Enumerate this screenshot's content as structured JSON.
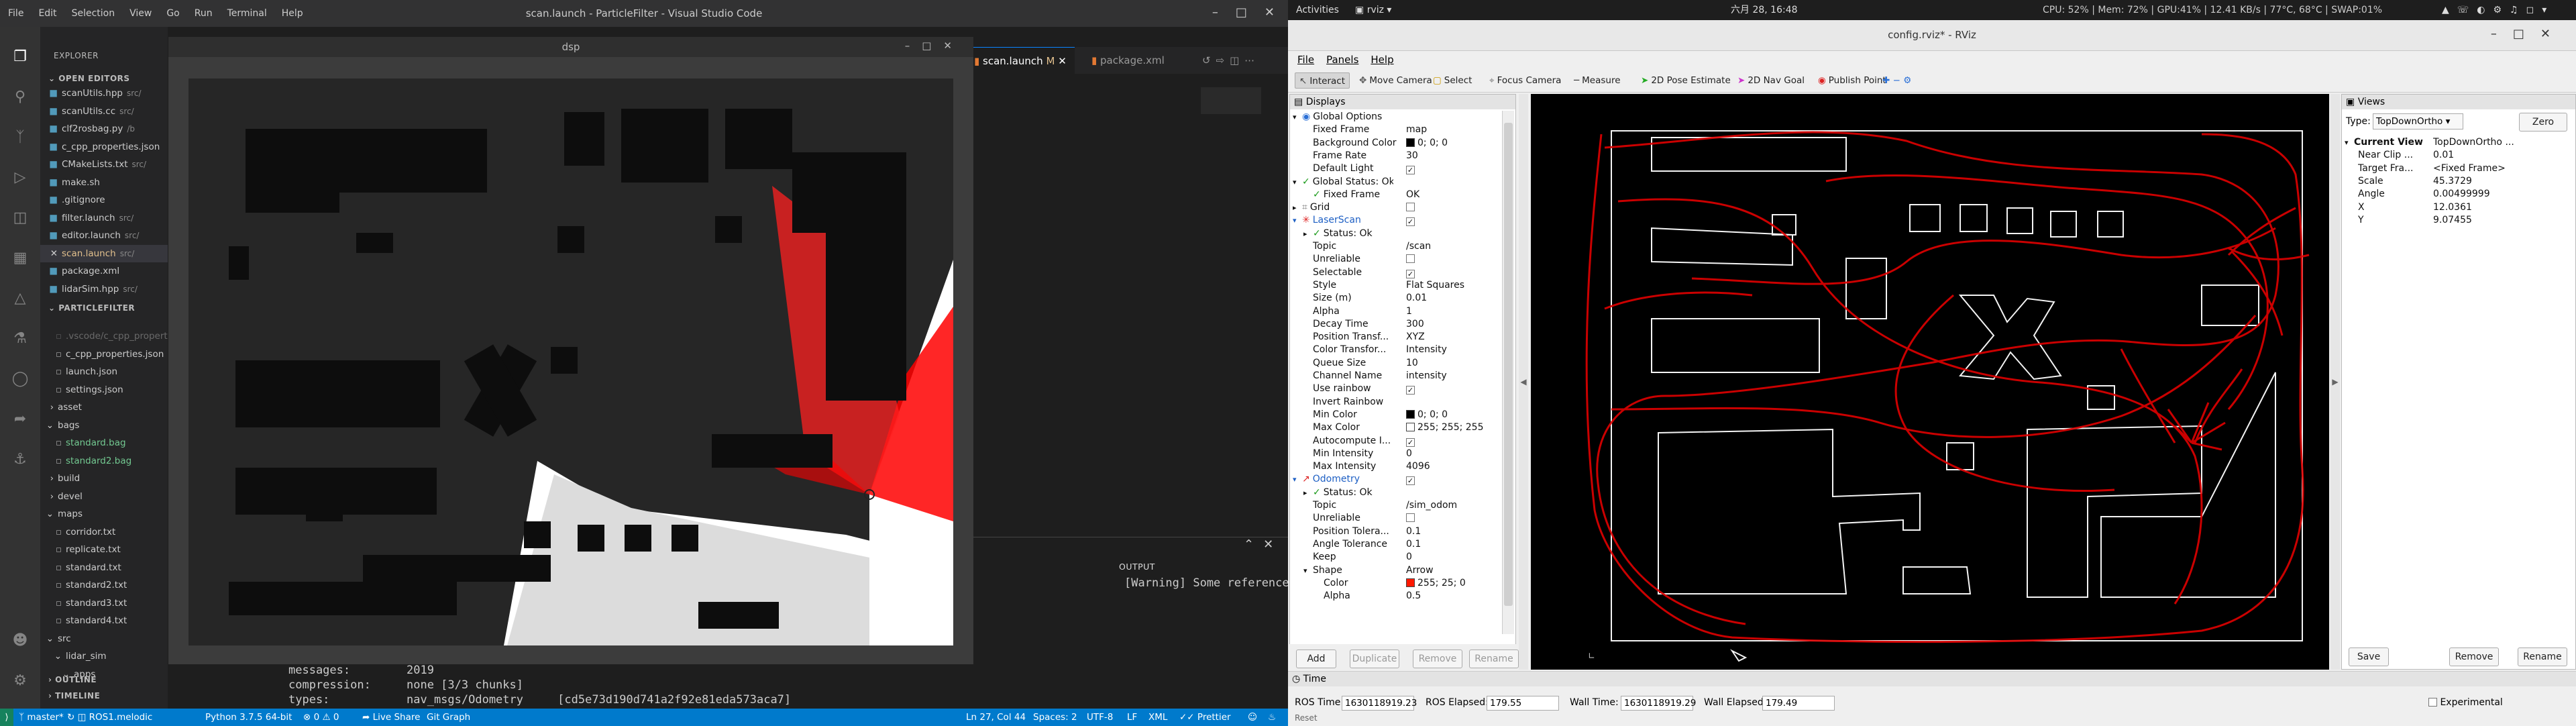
{
  "vscode": {
    "menu": [
      "File",
      "Edit",
      "Selection",
      "View",
      "Go",
      "Run",
      "Terminal",
      "Help"
    ],
    "window_title": "scan.launch - ParticleFilter - Visual Studio Code",
    "explorer_title": "EXPLORER",
    "open_editors_title": "OPEN EDITORS",
    "open_editors": [
      "scanUtils.hpp",
      "scanUtils.cc",
      "clf2rosbag.py",
      "c_cpp_properties.json",
      "CMakeLists.txt",
      "make.sh",
      ".gitignore",
      "filter.launch",
      "editor.launch",
      "scan.launch",
      "package.xml",
      "lidarSim.hpp"
    ],
    "open_editor_hints": [
      "src/",
      "src/",
      "/b",
      "",
      "src/",
      "",
      "",
      "src/",
      "src/",
      "src/",
      "",
      "src/"
    ],
    "project_title": "PARTICLEFILTER",
    "project_items": [
      ".vscode/c_cpp_properties.json",
      "c_cpp_properties.json",
      "launch.json",
      "settings.json",
      "asset",
      "bags",
      "standard.bag",
      "standard2.bag",
      "build",
      "devel",
      "maps",
      "corridor.txt",
      "replicate.txt",
      "standard.txt",
      "standard2.txt",
      "standard3.txt",
      "standard4.txt",
      "src",
      "lidar_sim",
      "apps"
    ],
    "outline_title": "OUTLINE",
    "timeline_title": "TIMELINE",
    "tabs": [
      "scan.launch",
      "package.xml"
    ],
    "tab_modified": "M",
    "dsp_title": "dsp",
    "output_tab": "OUTPUT",
    "output_text": "[Warning] Some references",
    "terminal_lines": [
      {
        "k": "messages:",
        "v": "2019"
      },
      {
        "k": "compression:",
        "v": "none [3/3 chunks]"
      },
      {
        "k": "types:",
        "v": "nav_msgs/Odometry     [cd5e73d190d741a2f92e81eda573aca7]"
      }
    ],
    "status": {
      "branch": "master*",
      "ros": "ROS1.melodic",
      "python": "Python 3.7.5 64-bit",
      "problems": "0 ⚠ 0",
      "live_share": "Live Share",
      "git_graph": "Git Graph",
      "position": "Ln 27, Col 44",
      "spaces": "Spaces: 2",
      "encoding": "UTF-8",
      "eol": "LF",
      "lang": "XML",
      "prettier": "Prettier"
    }
  },
  "gnome": {
    "activities": "Activities",
    "app": "rviz",
    "clock": "六月 28, 16:48",
    "stats": "CPU: 52% | Mem: 72% | GPU:41% | 12.41 KB/s | 77°C, 68°C | SWAP:01%"
  },
  "rviz": {
    "title": "config.rviz* - RViz",
    "menu": [
      "File",
      "Panels",
      "Help"
    ],
    "tools": [
      "Interact",
      "Move Camera",
      "Select",
      "Focus Camera",
      "Measure",
      "2D Pose Estimate",
      "2D Nav Goal",
      "Publish Point"
    ],
    "displays_title": "Displays",
    "display_rows": [
      {
        "k": "Global Options",
        "v": "",
        "lvl": 0,
        "exp": "▾",
        "icon": "globe"
      },
      {
        "k": "Fixed Frame",
        "v": "map",
        "lvl": 1
      },
      {
        "k": "Background Color",
        "v": "0; 0; 0",
        "lvl": 1,
        "sw": "#000000"
      },
      {
        "k": "Frame Rate",
        "v": "30",
        "lvl": 1
      },
      {
        "k": "Default Light",
        "v": "",
        "lvl": 1,
        "chk": "✓"
      },
      {
        "k": "Global Status: Ok",
        "v": "",
        "lvl": 0,
        "exp": "▾",
        "icon": "ok"
      },
      {
        "k": "Fixed Frame",
        "v": "OK",
        "lvl": 1,
        "icon": "ok"
      },
      {
        "k": "Grid",
        "v": "",
        "lvl": 0,
        "exp": "▸",
        "icon": "grid",
        "chk": " "
      },
      {
        "k": "LaserScan",
        "v": "",
        "lvl": 0,
        "exp": "▾",
        "icon": "laser",
        "chk": "✓",
        "blue": true
      },
      {
        "k": "Status: Ok",
        "v": "",
        "lvl": 1,
        "exp": "▸",
        "icon": "ok"
      },
      {
        "k": "Topic",
        "v": "/scan",
        "lvl": 1
      },
      {
        "k": "Unreliable",
        "v": "",
        "lvl": 1,
        "chk": " "
      },
      {
        "k": "Selectable",
        "v": "",
        "lvl": 1,
        "chk": "✓"
      },
      {
        "k": "Style",
        "v": "Flat Squares",
        "lvl": 1
      },
      {
        "k": "Size (m)",
        "v": "0.01",
        "lvl": 1
      },
      {
        "k": "Alpha",
        "v": "1",
        "lvl": 1
      },
      {
        "k": "Decay Time",
        "v": "300",
        "lvl": 1
      },
      {
        "k": "Position Transf...",
        "v": "XYZ",
        "lvl": 1
      },
      {
        "k": "Color Transfor...",
        "v": "Intensity",
        "lvl": 1
      },
      {
        "k": "Queue Size",
        "v": "10",
        "lvl": 1
      },
      {
        "k": "Channel Name",
        "v": "intensity",
        "lvl": 1
      },
      {
        "k": "Use rainbow",
        "v": "",
        "lvl": 1,
        "chk": "✓"
      },
      {
        "k": "Invert Rainbow",
        "v": "",
        "lvl": 1
      },
      {
        "k": "Min Color",
        "v": "0; 0; 0",
        "lvl": 1,
        "sw": "#000000"
      },
      {
        "k": "Max Color",
        "v": "255; 255; 255",
        "lvl": 1,
        "sw": "#ffffff"
      },
      {
        "k": "Autocompute I...",
        "v": "",
        "lvl": 1,
        "chk": "✓"
      },
      {
        "k": "Min Intensity",
        "v": "0",
        "lvl": 1
      },
      {
        "k": "Max Intensity",
        "v": "4096",
        "lvl": 1
      },
      {
        "k": "Odometry",
        "v": "",
        "lvl": 0,
        "exp": "▾",
        "icon": "odom",
        "chk": "✓",
        "blue": true
      },
      {
        "k": "Status: Ok",
        "v": "",
        "lvl": 1,
        "exp": "▸",
        "icon": "ok"
      },
      {
        "k": "Topic",
        "v": "/sim_odom",
        "lvl": 1
      },
      {
        "k": "Unreliable",
        "v": "",
        "lvl": 1,
        "chk": " "
      },
      {
        "k": "Position Tolera...",
        "v": "0.1",
        "lvl": 1
      },
      {
        "k": "Angle Tolerance",
        "v": "0.1",
        "lvl": 1
      },
      {
        "k": "Keep",
        "v": "0",
        "lvl": 1
      },
      {
        "k": "Shape",
        "v": "Arrow",
        "lvl": 1,
        "exp": "▾"
      },
      {
        "k": "Color",
        "v": "255; 25; 0",
        "lvl": 2,
        "sw": "#ff1900"
      },
      {
        "k": "Alpha",
        "v": "0.5",
        "lvl": 2
      }
    ],
    "display_buttons": [
      "Add",
      "Duplicate",
      "Remove",
      "Rename"
    ],
    "views_title": "Views",
    "views_type_label": "Type:",
    "views_type": "TopDownOrtho",
    "views_zero": "Zero",
    "view_rows": [
      {
        "k": "Current View",
        "v": "TopDownOrtho ...",
        "lvl": 0
      },
      {
        "k": "Near Clip ...",
        "v": "0.01",
        "lvl": 1
      },
      {
        "k": "Target Fra...",
        "v": "<Fixed Frame>",
        "lvl": 1
      },
      {
        "k": "Scale",
        "v": "45.3729",
        "lvl": 1
      },
      {
        "k": "Angle",
        "v": "0.00499999",
        "lvl": 1
      },
      {
        "k": "X",
        "v": "12.0361",
        "lvl": 1
      },
      {
        "k": "Y",
        "v": "9.07455",
        "lvl": 1
      }
    ],
    "view_buttons": [
      "Save",
      "Remove",
      "Rename"
    ],
    "time_title": "Time",
    "time": {
      "ros_time_label": "ROS Time:",
      "ros_time": "1630118919.23",
      "ros_elapsed_label": "ROS Elapsed:",
      "ros_elapsed": "179.55",
      "wall_time_label": "Wall Time:",
      "wall_time": "1630118919.29",
      "wall_elapsed_label": "Wall Elapsed:",
      "wall_elapsed": "179.49",
      "experimental": "Experimental",
      "reset": "Reset"
    }
  }
}
